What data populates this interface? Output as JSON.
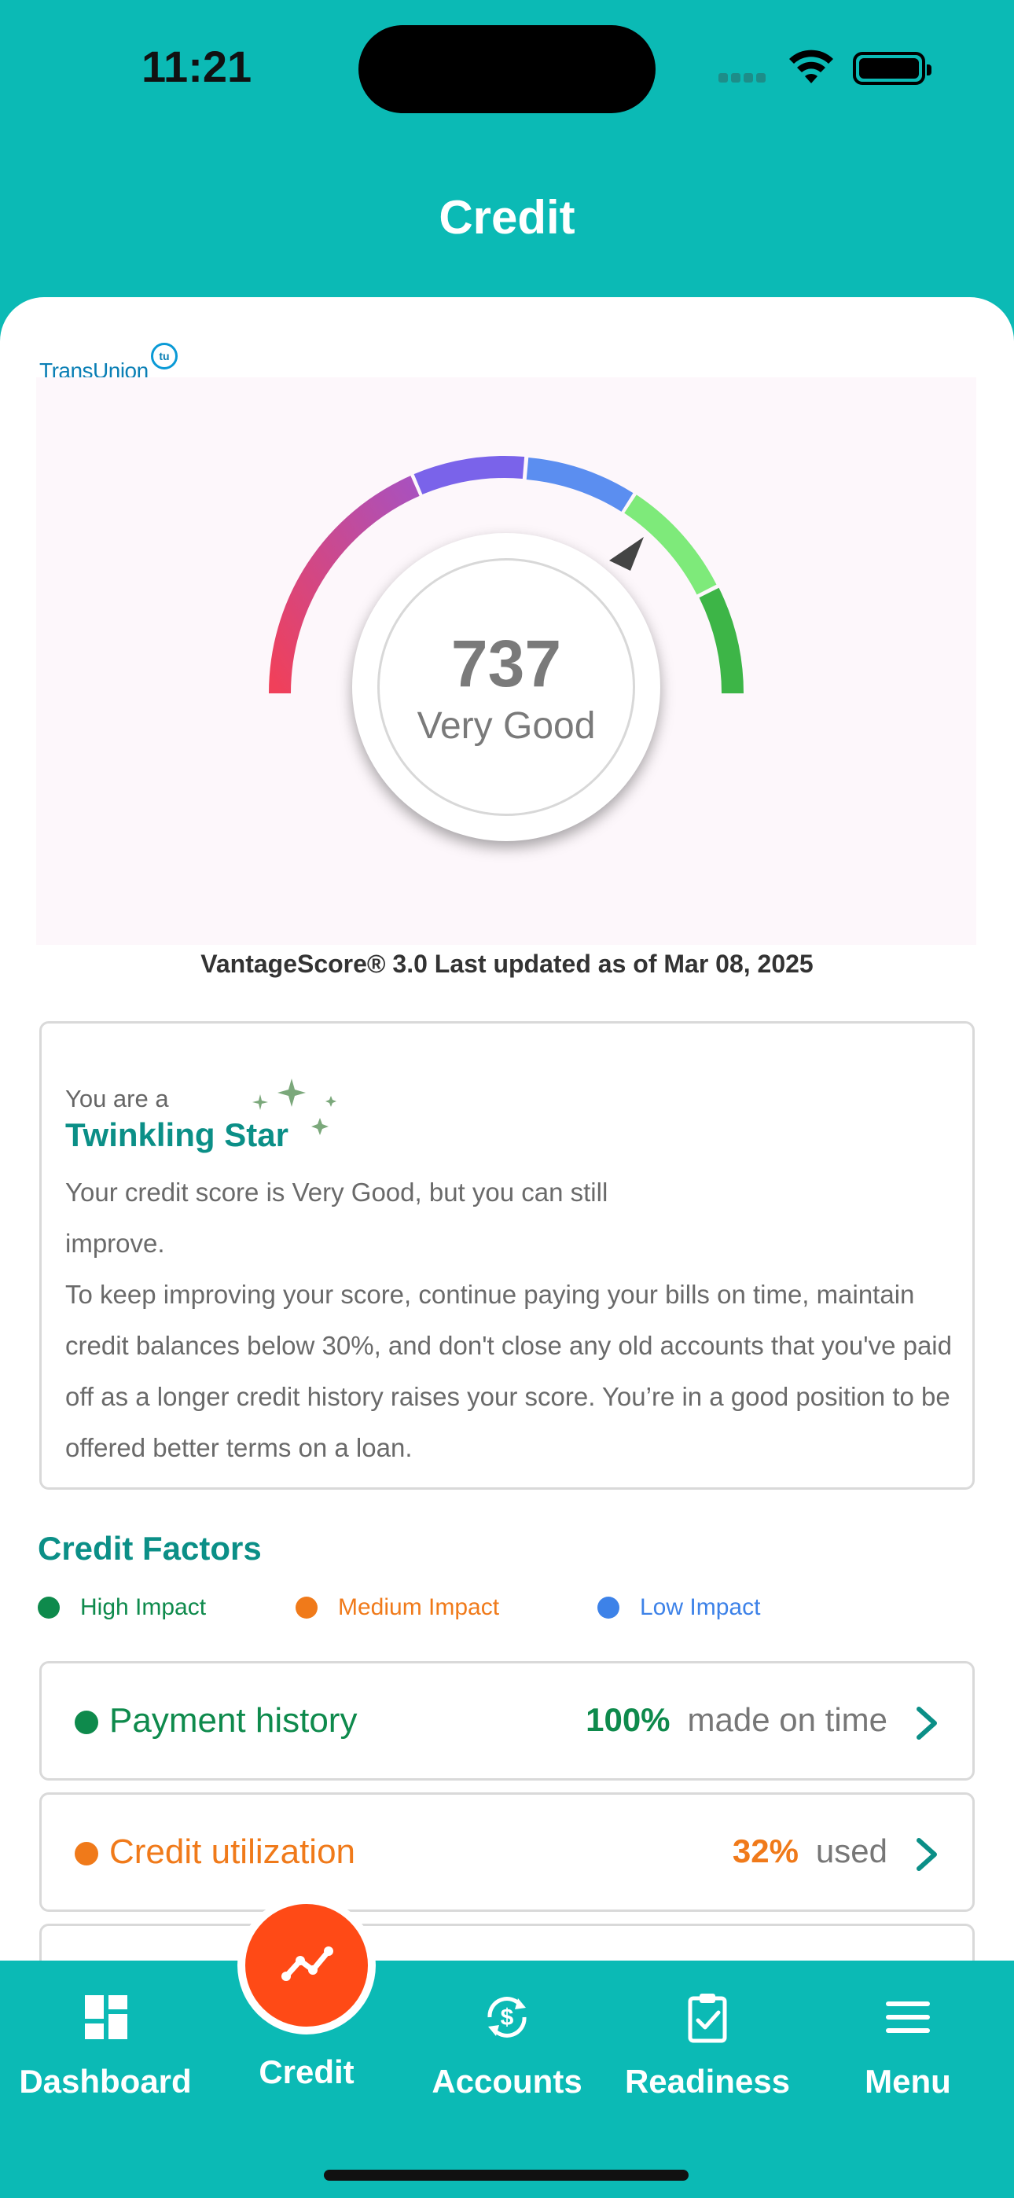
{
  "status_bar": {
    "time": "11:21"
  },
  "header": {
    "title": "Credit"
  },
  "bureau": {
    "name": "TransUnion",
    "badge": "tu"
  },
  "score": {
    "value": "737",
    "rating": "Very Good",
    "model_line": "VantageScore® 3.0 Last updated as of Mar 08, 2025",
    "gauge_segments": [
      {
        "name": "poor",
        "color_start": "#F0405A",
        "color_end": "#B64EB8"
      },
      {
        "name": "fair",
        "color": "#7A63EA"
      },
      {
        "name": "good",
        "color": "#5B8EF0"
      },
      {
        "name": "very-good",
        "color": "#7EEA7A"
      },
      {
        "name": "excellent",
        "color": "#3DB547"
      }
    ]
  },
  "star_card": {
    "prefix": "You are a",
    "title": "Twinkling Star",
    "line1": "Your credit score is Very Good, but you can still improve.",
    "line2": "To keep improving your score, continue paying your bills on time, maintain credit balances below 30%, and don't close any old accounts that you've paid off as a longer credit history raises your score. You’re in a good position to be offered better terms on a loan."
  },
  "factors": {
    "title": "Credit Factors",
    "legend": [
      {
        "label": "High Impact",
        "color": "#0E8A4C"
      },
      {
        "label": "Medium Impact",
        "color": "#F07A1A"
      },
      {
        "label": "Low Impact",
        "color": "#3D82E8"
      }
    ],
    "items": [
      {
        "name": "Payment history",
        "value": "100%",
        "suffix": "made on time",
        "color": "#0E8A4C"
      },
      {
        "name": "Credit utilization",
        "value": "32%",
        "suffix": "used",
        "color": "#F07A1A"
      }
    ]
  },
  "tabbar": {
    "tabs": [
      {
        "label": "Dashboard",
        "icon": "dashboard-icon"
      },
      {
        "label": "Credit",
        "icon": "chart-line-icon",
        "active": true
      },
      {
        "label": "Accounts",
        "icon": "dollar-sync-icon"
      },
      {
        "label": "Readiness",
        "icon": "clipboard-check-icon"
      },
      {
        "label": "Menu",
        "icon": "hamburger-menu-icon"
      }
    ]
  }
}
